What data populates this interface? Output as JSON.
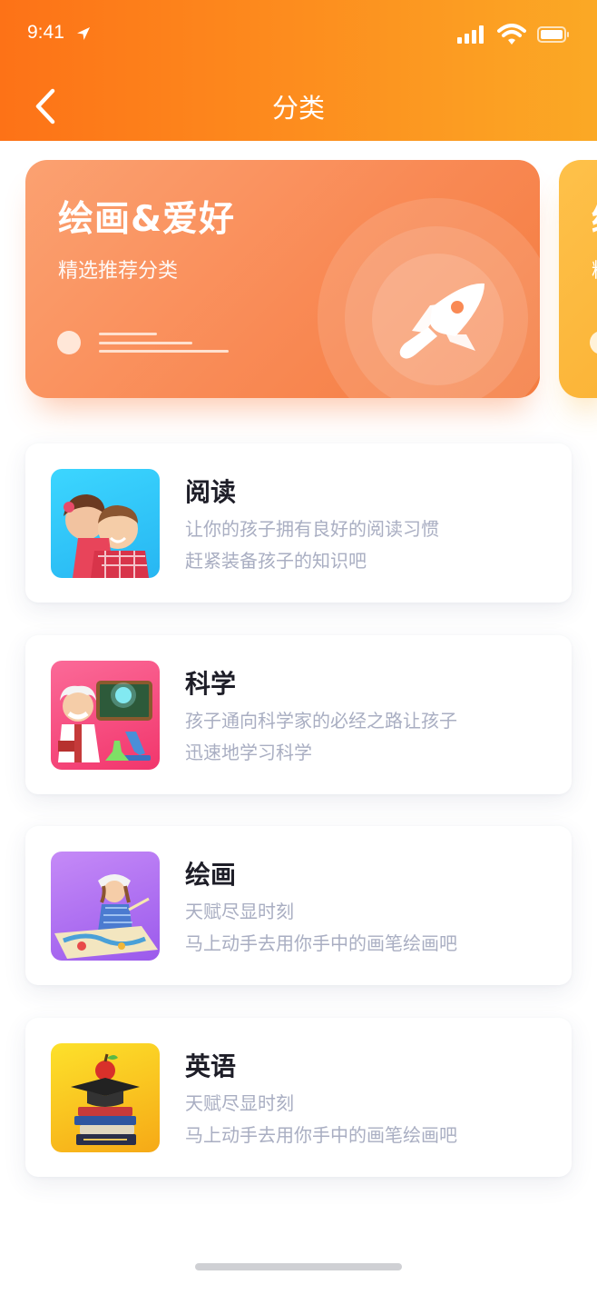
{
  "status_bar": {
    "time": "9:41"
  },
  "header": {
    "title": "分类"
  },
  "banner": {
    "title": "绘画&爱好",
    "subtitle": "精选推荐分类",
    "icon": "rocket-brush-icon"
  },
  "banner_next": {
    "title": "绘",
    "subtitle": "精"
  },
  "categories": [
    {
      "title": "阅读",
      "desc": [
        "让你的孩子拥有良好的阅读习惯",
        "赶紧装备孩子的知识吧"
      ],
      "image": "children-reading",
      "color": "#2fc8f5"
    },
    {
      "title": "科学",
      "desc": [
        "孩子通向科学家的必经之路让孩子",
        "迅速地学习科学"
      ],
      "image": "scientist-lab",
      "color": "#f5457c"
    },
    {
      "title": "绘画",
      "desc": [
        "天赋尽显时刻",
        "马上动手去用你手中的画笔绘画吧"
      ],
      "image": "girl-painting",
      "color": "#a56cf0"
    },
    {
      "title": "英语",
      "desc": [
        "天赋尽显时刻",
        "马上动手去用你手中的画笔绘画吧"
      ],
      "image": "books-apple",
      "color": "#fbc51c"
    }
  ],
  "colors": {
    "header_start": "#fd7217",
    "header_end": "#fba925",
    "banner": "#f98a55",
    "title": "#1e1e28",
    "desc": "#a9aec2"
  }
}
